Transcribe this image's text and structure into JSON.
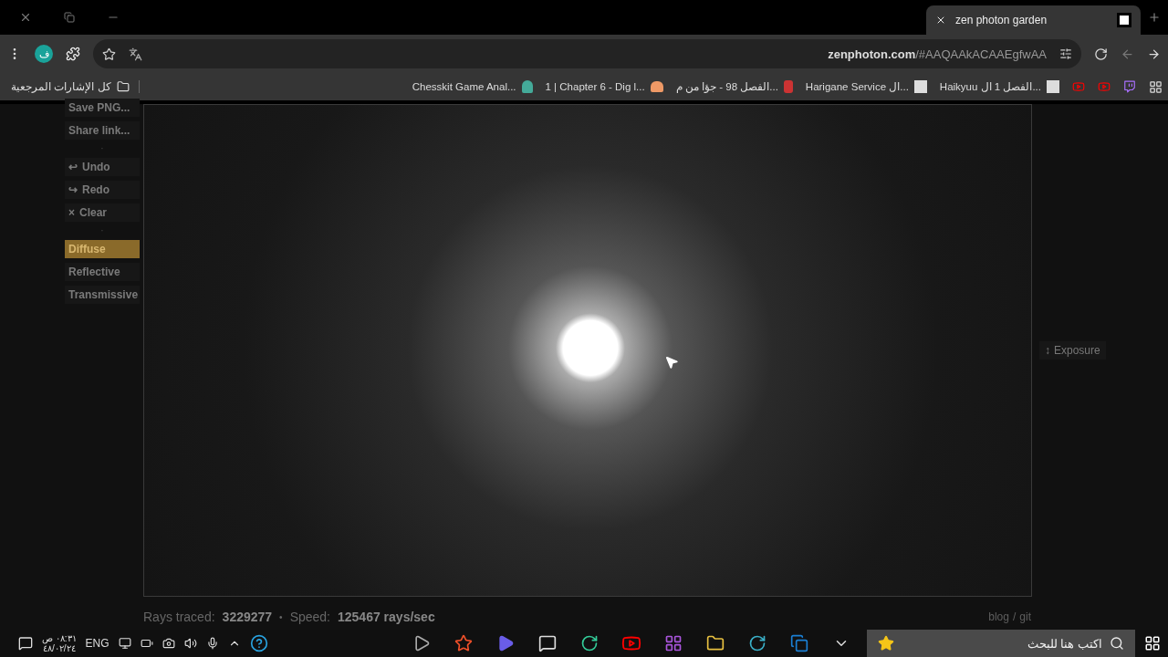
{
  "tab": {
    "title": "zen photon garden",
    "active": true
  },
  "address": {
    "domain": "zenphoton.com",
    "path": "/#AAQAAkACAAEgfwAA"
  },
  "profile": {
    "initial": "ف"
  },
  "bookmarks_all": "كل الإشارات المرجعية",
  "bookmarks": [
    {
      "label": "Chesskit Game Anal...",
      "kind": "chess"
    },
    {
      "label": "1 | Chapter 6 - Dig l...",
      "kind": "cake"
    },
    {
      "label": "الفصل 98 - جؤا من م...",
      "kind": "number"
    },
    {
      "label": "Harigane Service ال...",
      "kind": "manga"
    },
    {
      "label": "Haikyuu الفصل 1 ال...",
      "kind": "manga"
    },
    {
      "kind": "youtube"
    },
    {
      "kind": "youtube"
    },
    {
      "kind": "twitch"
    }
  ],
  "sidebar": [
    {
      "kind": "button",
      "label": "Save PNG..."
    },
    {
      "kind": "button",
      "label": "Share link..."
    },
    {
      "kind": "separator",
      "label": "·"
    },
    {
      "kind": "button",
      "label": "Undo",
      "icon": "↩"
    },
    {
      "kind": "button",
      "label": "Redo",
      "icon": "↪"
    },
    {
      "kind": "button",
      "label": "Clear",
      "icon": "×"
    },
    {
      "kind": "separator",
      "label": "·"
    },
    {
      "kind": "material",
      "label": "Diffuse",
      "selected": true
    },
    {
      "kind": "material",
      "label": "Reflective",
      "selected": false
    },
    {
      "kind": "material",
      "label": "Transmissive",
      "selected": false
    }
  ],
  "exposure": {
    "icon": "↕",
    "label": "Exposure"
  },
  "status": {
    "rays_label": "Rays traced:",
    "rays": "3229277",
    "sep": "•",
    "speed_label": "Speed:",
    "speed": "125467 rays/sec"
  },
  "links": {
    "blog": "blog",
    "sep": "/",
    "git": "git"
  },
  "taskbar": {
    "time": "٠٨:٣١ ص",
    "date": "٤٨/٠٢/٢٤",
    "lang": "ENG",
    "search_placeholder": "اكتب هنا للبحث"
  }
}
